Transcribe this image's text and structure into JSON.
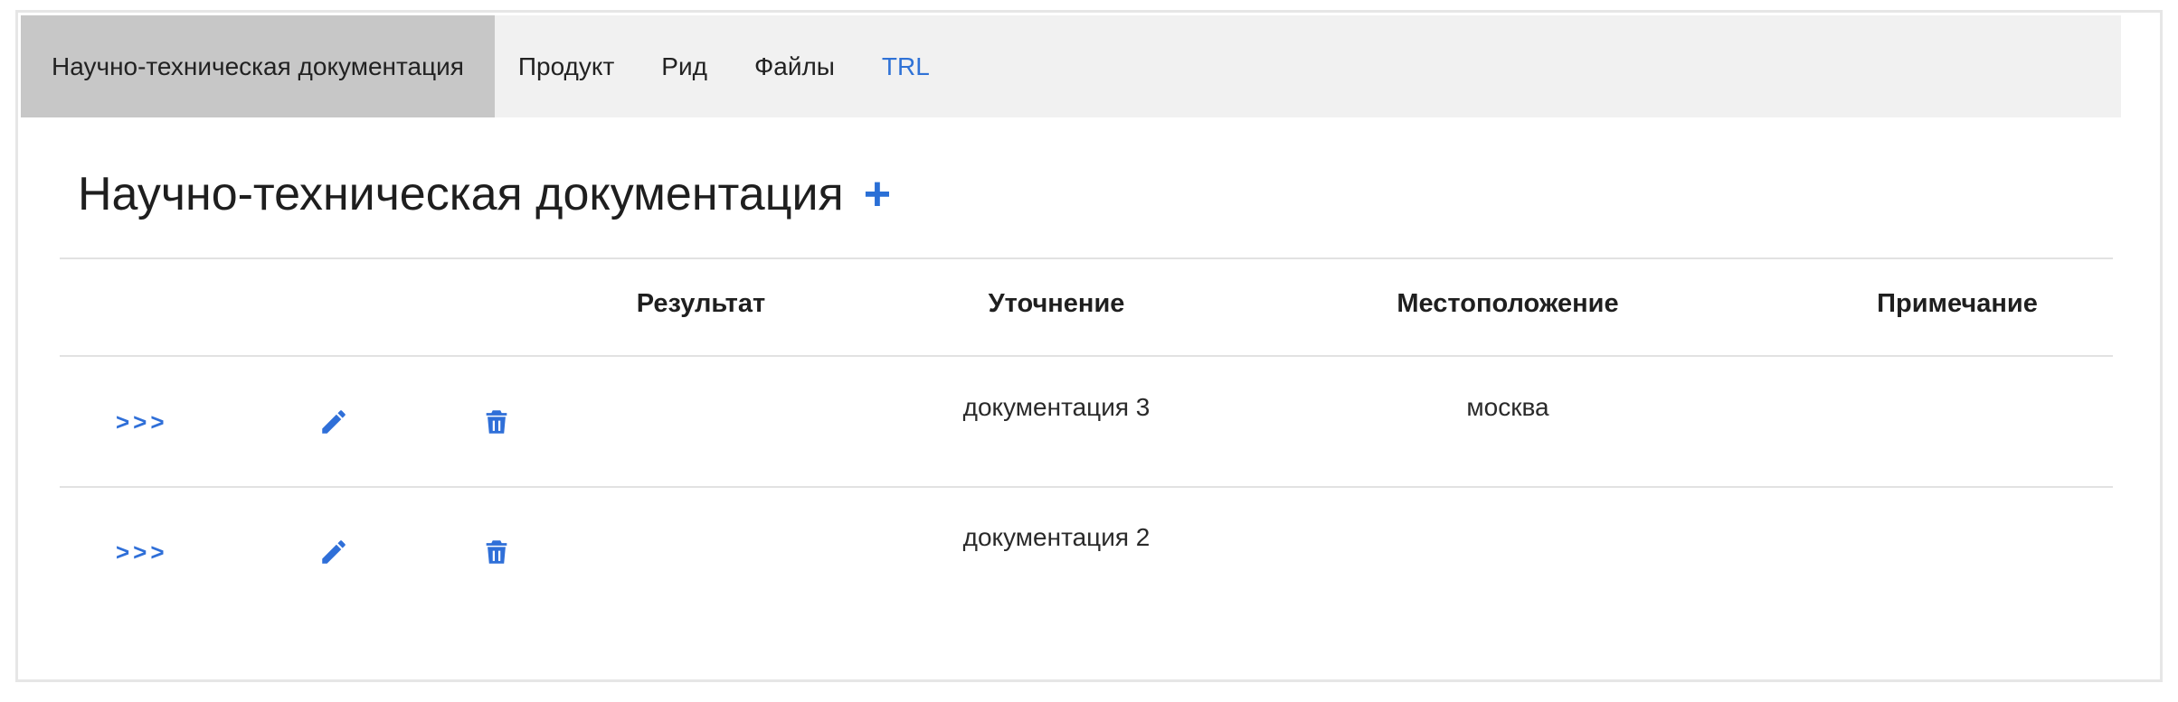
{
  "tabs": [
    {
      "label": "Научно-техническая документация",
      "active": true
    },
    {
      "label": "Продукт"
    },
    {
      "label": "Рид"
    },
    {
      "label": "Файлы"
    },
    {
      "label": "TRL"
    }
  ],
  "section": {
    "title": "Научно-техническая документация",
    "add_label": "+"
  },
  "table": {
    "columns": [
      "Результат",
      "Уточнение",
      "Местоположение",
      "Примечание"
    ],
    "rows": [
      {
        "open_label": ">>>",
        "result": "",
        "clarification": "документация 3",
        "location": "москва",
        "note": ""
      },
      {
        "open_label": ">>>",
        "result": "",
        "clarification": "документация 2",
        "location": "",
        "note": ""
      }
    ]
  },
  "icons": {
    "edit": "pencil-icon",
    "delete": "trash-icon"
  },
  "colors": {
    "accent": "#2f6fd8",
    "tabbar_bg": "#f1f1f1",
    "active_tab_bg": "#c7c7c7"
  }
}
